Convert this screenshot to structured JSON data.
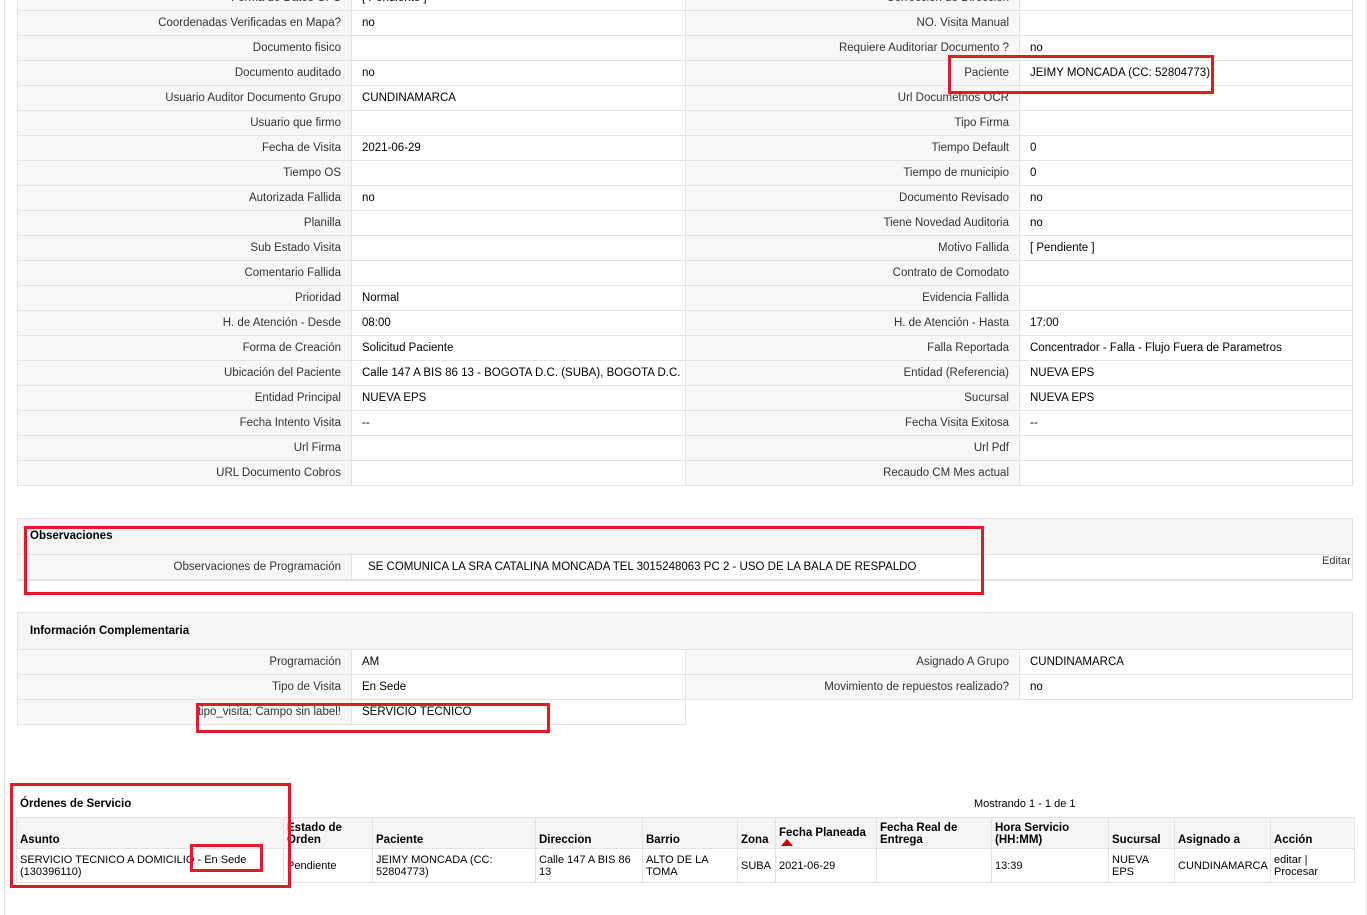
{
  "details": [
    [
      "Forma de Datos GPS",
      "[ Pendiente ]",
      "Corrección de Dirección",
      ""
    ],
    [
      "Coordenadas Verificadas en Mapa?",
      "no",
      "NO. Visita Manual",
      ""
    ],
    [
      "Documento fisico",
      "",
      "Requiere Auditoriar Documento ?",
      "no"
    ],
    [
      "Documento auditado",
      "no",
      "Paciente",
      "JEIMY MONCADA (CC: 52804773)"
    ],
    [
      "Usuario Auditor Documento Grupo",
      "CUNDINAMARCA",
      "Url Documetnos OCR",
      ""
    ],
    [
      "Usuario que firmo",
      "",
      "Tipo Firma",
      ""
    ],
    [
      "Fecha de Visita",
      "2021-06-29",
      "Tiempo Default",
      "0"
    ],
    [
      "Tiempo OS",
      "",
      "Tiempo de municipio",
      "0"
    ],
    [
      "Autorizada Fallida",
      "no",
      "Documento Revisado",
      "no"
    ],
    [
      "Planilla",
      "",
      "Tiene Novedad Auditoria",
      "no"
    ],
    [
      "Sub Estado Visita",
      "",
      "Motivo Fallida",
      "[ Pendiente ]"
    ],
    [
      "Comentario Fallida",
      "",
      "Contrato de Comodato",
      ""
    ],
    [
      "Prioridad",
      "Normal",
      "Evidencia Fallida",
      ""
    ],
    [
      "H. de Atención - Desde",
      "08:00",
      "H. de Atención - Hasta",
      "17:00"
    ],
    [
      "Forma de Creación",
      "Solicitud Paciente",
      "Falla Reportada",
      "Concentrador - Falla - Flujo Fuera de Parametros"
    ],
    [
      "Ubicación del Paciente",
      "Calle 147 A BIS 86 13 - BOGOTA D.C. (SUBA), BOGOTA D.C.",
      "Entidad (Referencia)",
      "NUEVA EPS"
    ],
    [
      "Entidad Principal",
      "NUEVA EPS",
      "Sucursal",
      "NUEVA EPS"
    ],
    [
      "Fecha Intento Visita",
      "--",
      "Fecha Visita Exitosa",
      "--"
    ],
    [
      "Url Firma",
      "",
      "Url Pdf",
      ""
    ],
    [
      "URL Documento Cobros",
      "",
      "Recaudo CM Mes actual",
      ""
    ]
  ],
  "observaciones": {
    "title": "Observaciones",
    "label": "Observaciones de Programación",
    "value": "SE COMUNICA LA SRA CATALINA MONCADA TEL 3015248063 PC 2 - USO DE LA BALA DE RESPALDO",
    "edit": "Editar"
  },
  "complementaria": {
    "title": "Información Complementaria",
    "rows": [
      [
        "Programación",
        "AM",
        "Asignado A Grupo",
        "CUNDINAMARCA"
      ],
      [
        "Tipo de Visita",
        "En Sede",
        "Movimiento de repuestos realizado?",
        "no"
      ],
      [
        "tipo_visita: Campo sin label!",
        "SERVICIO TECNICO"
      ]
    ]
  },
  "ordenes": {
    "title": "Órdenes de Servicio",
    "showing": "Mostrando 1 - 1 de 1",
    "headers": [
      "Asunto",
      "Estado de Orden",
      "Paciente",
      "Direccion",
      "Barrio",
      "Zona",
      "Fecha Planeada",
      "Fecha Real de Entrega",
      "Hora Servicio (HH:MM)",
      "Sucursal",
      "Asignado a",
      "Acción"
    ],
    "row": {
      "asunto_main": "SERVICIO TECNICO A DOMICILIO",
      "asunto_sede": " - En Sede",
      "asunto_id": "(130396110)",
      "estado": "Pendiente",
      "paciente": "JEIMY MONCADA (CC: 52804773)",
      "direccion": "Calle 147 A BIS 86 13",
      "barrio": "ALTO DE LA TOMA",
      "zona": "SUBA",
      "fecha_planeada": "2021-06-29",
      "fecha_real": "",
      "hora": "13:39",
      "sucursal": "NUEVA EPS",
      "asignado": "CUNDINAMARCA",
      "accion_editar": "editar",
      "accion_sep": " | ",
      "accion_procesar": "Procesar"
    }
  },
  "colors": {
    "highlight": "#e21b26",
    "sort_arrow": "#c00000"
  }
}
